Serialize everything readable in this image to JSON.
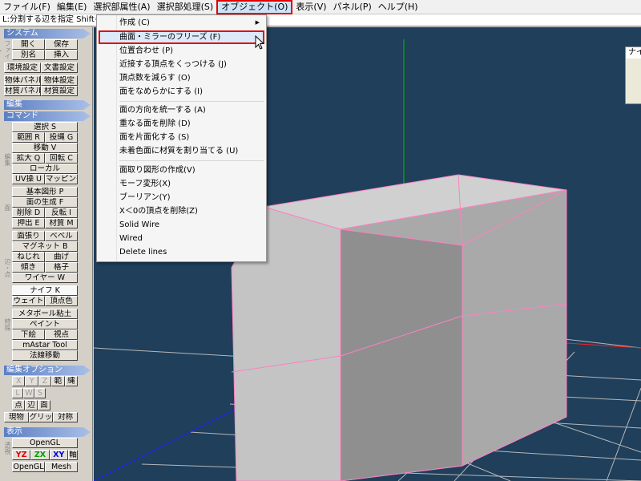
{
  "menubar": {
    "items": [
      {
        "label": "ファイル(F)"
      },
      {
        "label": "編集(E)"
      },
      {
        "label": "選択部属性(A)"
      },
      {
        "label": "選択部処理(S)"
      },
      {
        "label": "オブジェクト(O)"
      },
      {
        "label": "表示(V)"
      },
      {
        "label": "パネル(P)"
      },
      {
        "label": "ヘルプ(H)"
      }
    ]
  },
  "status_text": "L:分割する辺を指定  Shift+L",
  "sidebar": {
    "system": {
      "header": "システム",
      "side_label": "ファイル",
      "open": "開く",
      "save": "保存",
      "save_as": "別名",
      "insert": "挿入",
      "env_settings": "環境設定",
      "doc_settings": "文書設定",
      "object_panel": "物体パネル",
      "object_settings": "物体設定",
      "material_panel": "材質パネル",
      "material_settings": "材質設定"
    },
    "edit": {
      "header": "編集",
      "command_header": "コマンド",
      "side_label_1": "編集",
      "select": "選択 S",
      "range": "範囲 R",
      "lasso": "投縄 G",
      "move": "移動 V",
      "scale": "拡大 Q",
      "rotate": "回転 C",
      "local": "ローカル",
      "uv": "UV操 U",
      "mapping": "マッピング",
      "side_label_2": "面",
      "basic_shape": "基本図形 P",
      "face_gen": "面の生成 F",
      "delete": "削除 D",
      "flip": "反転 I",
      "extrude": "押出 E",
      "material": "材質 M",
      "side_label_3": "辺・点",
      "stretch": "面張り",
      "bevel": "ベベル",
      "magnet": "マグネット B",
      "twist": "ねじれ",
      "bend": "曲げ",
      "tilt": "傾き",
      "lattice": "格子",
      "wire": "ワイヤー W",
      "knife": "ナイフ K",
      "weight": "ウェイト",
      "vertex_color": "頂点色",
      "side_label_4": "特殊",
      "metaball": "メタボール粘土",
      "paint": "ペイント",
      "underlay": "下絵",
      "viewpoint": "視点",
      "mastar": "mAstar Tool",
      "normal_move": "法線移動"
    },
    "options": {
      "header": "編集オプション",
      "x": "X",
      "y": "Y",
      "z": "Z",
      "range": "範",
      "lasso": "縄",
      "l": "L",
      "w": "W",
      "s": "S",
      "point": "点",
      "edge": "辺",
      "face": "面",
      "current": "現物",
      "grid": "グリッド",
      "symmetry": "対称"
    },
    "display": {
      "header": "表示",
      "side_label": "透視",
      "opengl": "OpenGL",
      "yz": "YZ",
      "zx": "ZX",
      "xy": "XY",
      "axis": "軸",
      "opengl2": "OpenGL",
      "mesh": "Mesh"
    }
  },
  "nav_panel_title": "ナイ",
  "dropdown": {
    "items": [
      {
        "label": "作成 (C)",
        "submenu": true
      },
      {
        "label": "曲面・ミラーのフリーズ (F)",
        "highlighted": true
      },
      {
        "label": "位置合わせ (P)"
      },
      {
        "label": "近接する頂点をくっつける (J)"
      },
      {
        "label": "頂点数を減らす (O)"
      },
      {
        "label": "面をなめらかにする (I)"
      },
      {
        "label": "面の方向を統一する (A)"
      },
      {
        "label": "重なる面を削除 (D)"
      },
      {
        "label": "面を片面化する (S)"
      },
      {
        "label": "未着色面に材質を割り当てる (U)"
      },
      {
        "label": "面取り図形の作成(V)"
      },
      {
        "label": "モーフ変形(X)"
      },
      {
        "label": "ブーリアン(Y)"
      },
      {
        "label": "X＜0の頂点を削除(Z)"
      },
      {
        "label": "Solid Wire"
      },
      {
        "label": "Wired"
      },
      {
        "label": "Delete lines"
      }
    ]
  },
  "colors": {
    "viewport_bg": "#1f3f5b",
    "grid_line": "#b7b7b7",
    "x_axis": "#ff2020",
    "y_axis": "#00c000",
    "z_axis": "#2020ff",
    "cube_edge": "#ff80c0",
    "highlight_border": "#e00000"
  },
  "icons": {
    "submenu": "submenu-arrow-icon",
    "cursor": "mouse-pointer-icon"
  }
}
